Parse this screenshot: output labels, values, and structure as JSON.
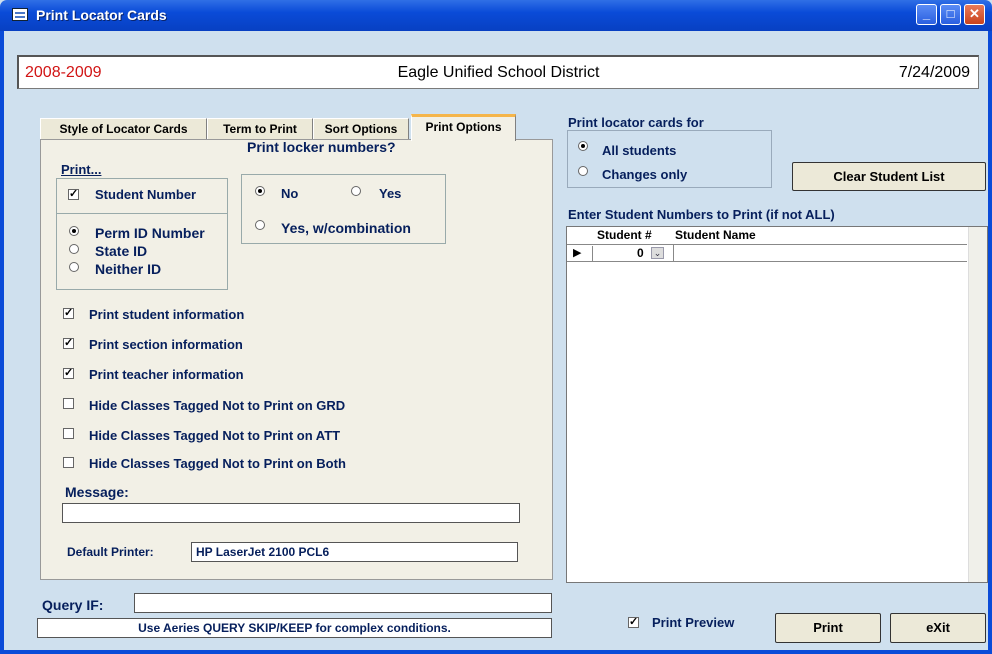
{
  "window": {
    "title": "Print Locator Cards"
  },
  "header": {
    "year": "2008-2009",
    "district": "Eagle Unified School District",
    "date": "7/24/2009"
  },
  "tabs": [
    {
      "label": "Style of Locator Cards",
      "active": false
    },
    {
      "label": "Term to Print",
      "active": false
    },
    {
      "label": "Sort Options",
      "active": false
    },
    {
      "label": "Print Options",
      "active": true
    }
  ],
  "print_options": {
    "print_heading": "Print...",
    "student_number": {
      "label": "Student Number",
      "checked": true
    },
    "id_options": [
      {
        "label": "Perm ID Number",
        "selected": true
      },
      {
        "label": "State ID",
        "selected": false
      },
      {
        "label": "Neither ID",
        "selected": false
      }
    ],
    "locker_heading": "Print locker numbers?",
    "locker_options": [
      {
        "label": "No",
        "selected": true
      },
      {
        "label": "Yes",
        "selected": false
      },
      {
        "label": "Yes, w/combination",
        "selected": false
      }
    ],
    "checkboxes": [
      {
        "label": "Print student information",
        "checked": true
      },
      {
        "label": "Print section information",
        "checked": true
      },
      {
        "label": "Print teacher information",
        "checked": true
      },
      {
        "label": "Hide Classes Tagged Not to Print on GRD",
        "checked": false
      },
      {
        "label": "Hide Classes Tagged Not to Print on ATT",
        "checked": false
      },
      {
        "label": "Hide Classes Tagged Not to Print on Both",
        "checked": false
      }
    ],
    "message_label": "Message:",
    "message_value": "",
    "default_printer_label": "Default Printer:",
    "default_printer_value": "HP LaserJet 2100 PCL6"
  },
  "cards_for": {
    "heading": "Print locator cards for",
    "options": [
      {
        "label": "All students",
        "selected": true
      },
      {
        "label": "Changes only",
        "selected": false
      }
    ]
  },
  "clear_button": {
    "label": "Clear Student List"
  },
  "student_list": {
    "heading": "Enter Student Numbers to Print (if not ALL)",
    "col_student_num": "Student #",
    "col_student_name": "Student Name",
    "rows": [
      {
        "student_num": "0",
        "name": ""
      }
    ]
  },
  "query": {
    "label": "Query IF:",
    "value": "",
    "hint": "Use Aeries QUERY SKIP/KEEP for complex conditions."
  },
  "print_preview": {
    "label": "Print Preview",
    "checked": true
  },
  "buttons": {
    "print": "Print",
    "exit": "eXit"
  },
  "colors": {
    "titlebar": "#0a4bd8",
    "background": "#cfe0ee",
    "label": "#061f5c",
    "year": "#d11414",
    "active_tab_accent": "#f5b54a"
  }
}
